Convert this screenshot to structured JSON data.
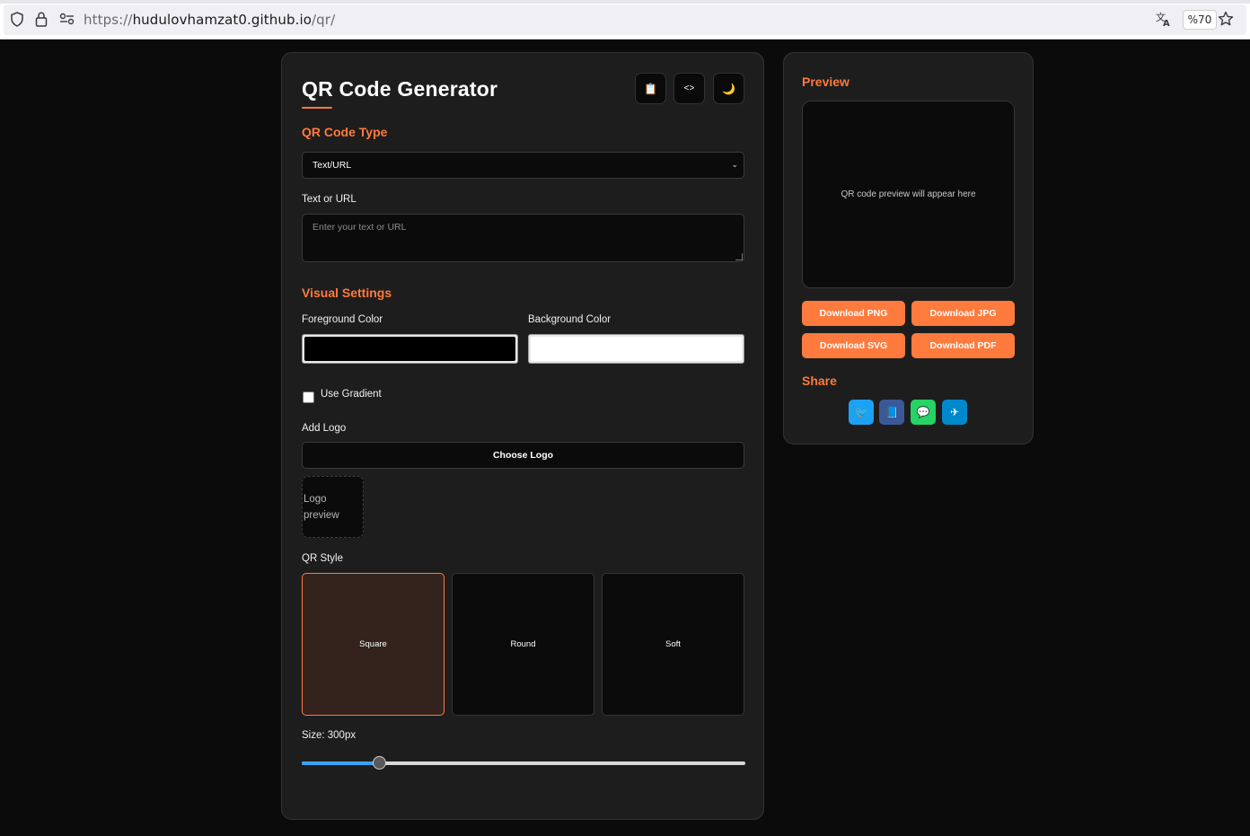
{
  "browser": {
    "url_prefix": "https://",
    "url_host": "hudulovhamzat0.github.io",
    "url_path": "/qr/",
    "zoom": "%70"
  },
  "header": {
    "title": "QR Code Generator",
    "buttons": [
      {
        "icon": "clipboard-icon",
        "glyph": "📋"
      },
      {
        "icon": "code-icon",
        "glyph": "<>"
      },
      {
        "icon": "moon-icon",
        "glyph": "🌙"
      }
    ]
  },
  "qr_type": {
    "section_title": "QR Code Type",
    "selected": "Text/URL"
  },
  "text_input": {
    "label": "Text or URL",
    "placeholder": "Enter your text or URL",
    "value": ""
  },
  "visual": {
    "section_title": "Visual Settings",
    "fg_label": "Foreground Color",
    "fg_color": "#000000",
    "bg_label": "Background Color",
    "bg_color": "#ffffff",
    "gradient_label": "Use Gradient",
    "gradient_checked": false
  },
  "logo": {
    "label": "Add Logo",
    "button": "Choose Logo",
    "preview_line1": "Logo",
    "preview_line2": "preview"
  },
  "qr_style": {
    "label": "QR Style",
    "options": [
      "Square",
      "Round",
      "Soft"
    ],
    "selected": "Square"
  },
  "size": {
    "label": "Size: 300px",
    "value_fraction": 0.175
  },
  "preview": {
    "title": "Preview",
    "placeholder": "QR code preview will appear here"
  },
  "downloads": [
    "Download PNG",
    "Download JPG",
    "Download SVG",
    "Download PDF"
  ],
  "share": {
    "title": "Share",
    "buttons": [
      {
        "icon": "twitter-icon",
        "color": "#1da1f2",
        "glyph": "🐦"
      },
      {
        "icon": "facebook-icon",
        "color": "#3b5998",
        "glyph": "📘"
      },
      {
        "icon": "whatsapp-icon",
        "color": "#25d366",
        "glyph": "💬"
      },
      {
        "icon": "telegram-icon",
        "color": "#0088cc",
        "glyph": "✈"
      }
    ]
  },
  "colors": {
    "accent": "#ff7a3d",
    "panel": "#1d1d1d",
    "page_bg": "#0b0b0b"
  }
}
